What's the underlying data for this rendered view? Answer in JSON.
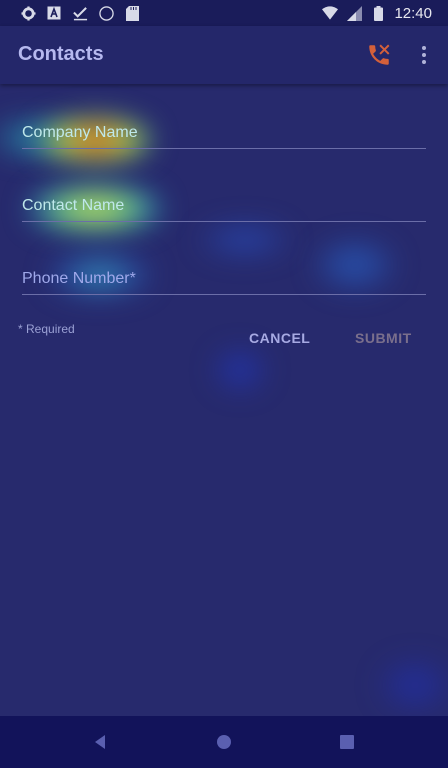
{
  "status_bar": {
    "time": "12:40",
    "left_icons": [
      "settings-icon",
      "a-box-icon",
      "check-icon",
      "circle-icon",
      "sd-card-icon"
    ],
    "right_icons": [
      "wifi-icon",
      "cell-signal-icon",
      "battery-icon"
    ]
  },
  "app_bar": {
    "title": "Contacts",
    "actions": [
      "phone-icon",
      "more-vert-icon"
    ],
    "accent_color": "#d4603a"
  },
  "form": {
    "fields": [
      {
        "label": "Company Name",
        "value": ""
      },
      {
        "label": "Contact Name",
        "value": ""
      },
      {
        "label": "Phone Number*",
        "value": ""
      }
    ],
    "required_note": "* Required",
    "cancel_label": "CANCEL",
    "submit_label": "SUBMIT"
  },
  "nav_bar": {
    "buttons": [
      "back-icon",
      "home-icon",
      "recents-icon"
    ]
  }
}
